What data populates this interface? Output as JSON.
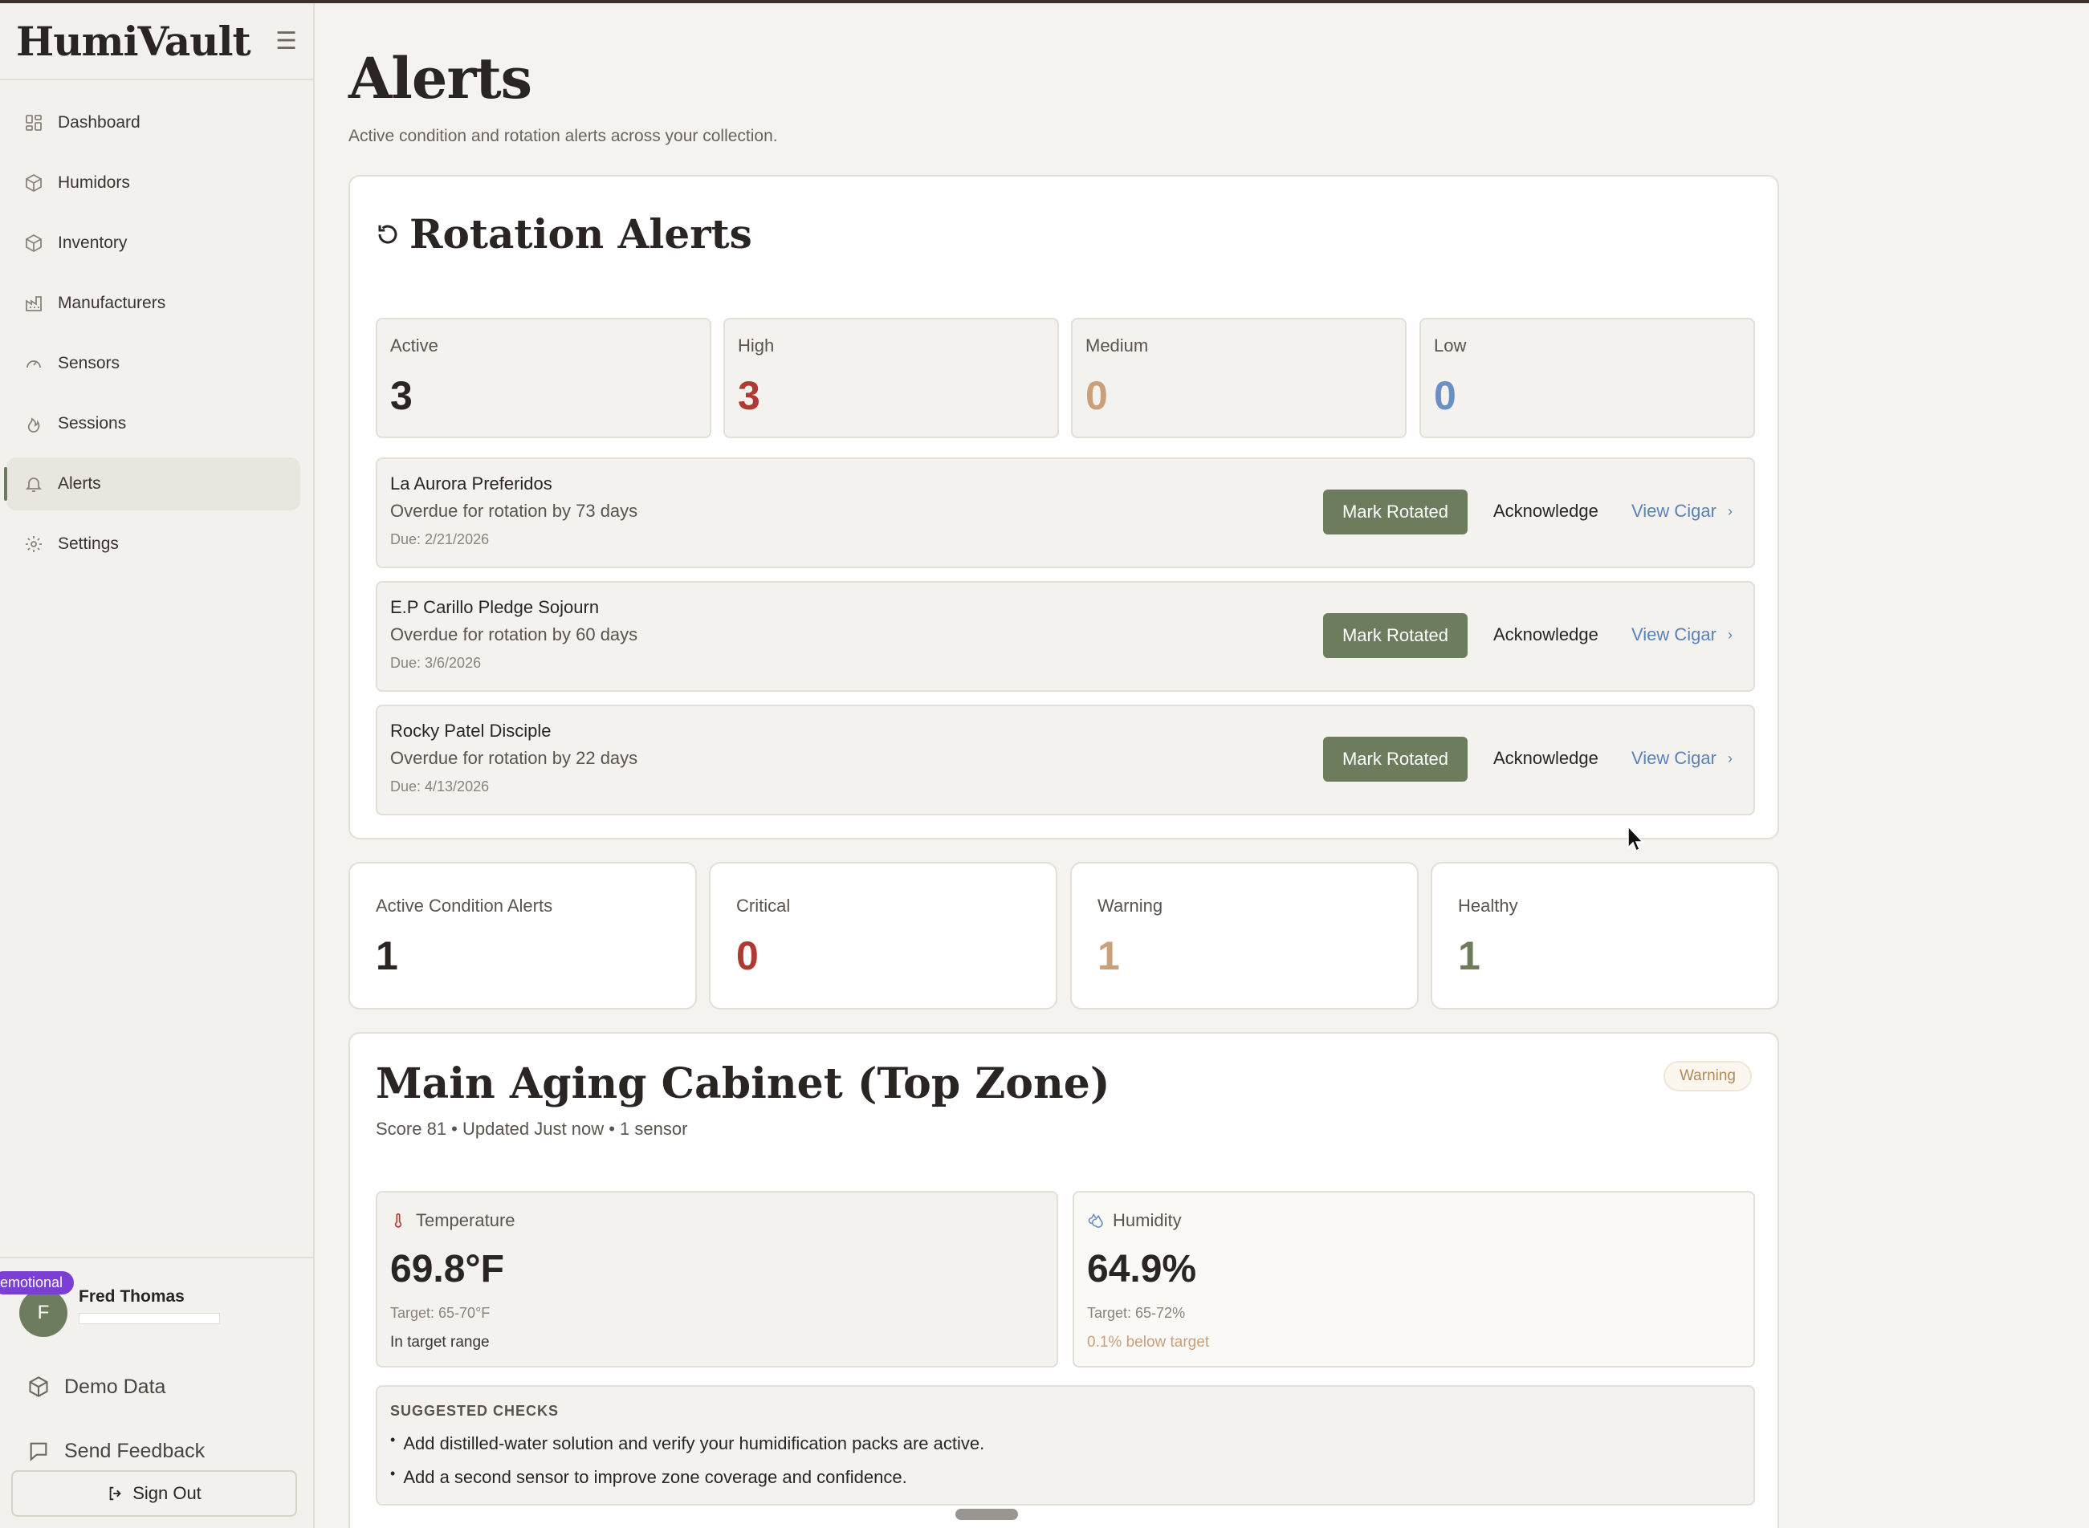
{
  "app": {
    "brand": "HumiVault"
  },
  "sidebar": {
    "items": [
      {
        "label": "Dashboard",
        "icon": "dashboard-icon"
      },
      {
        "label": "Humidors",
        "icon": "box-icon"
      },
      {
        "label": "Inventory",
        "icon": "box-icon"
      },
      {
        "label": "Manufacturers",
        "icon": "factory-icon"
      },
      {
        "label": "Sensors",
        "icon": "gauge-icon"
      },
      {
        "label": "Sessions",
        "icon": "flame-icon"
      },
      {
        "label": "Alerts",
        "icon": "bell-icon",
        "active": true
      },
      {
        "label": "Settings",
        "icon": "gear-icon"
      }
    ],
    "user": {
      "name": "Fred Thomas",
      "initial": "F",
      "badge": "emotional"
    },
    "demo_data": "Demo Data",
    "send_feedback": "Send Feedback",
    "sign_out": "Sign Out"
  },
  "page": {
    "title": "Alerts",
    "subtitle": "Active condition and rotation alerts across your collection."
  },
  "rotation": {
    "title": "Rotation Alerts",
    "stats": [
      {
        "label": "Active",
        "value": "3",
        "color": "#2a2522"
      },
      {
        "label": "High",
        "value": "3",
        "color": "#b03a33"
      },
      {
        "label": "Medium",
        "value": "0",
        "color": "#c9a07a"
      },
      {
        "label": "Low",
        "value": "0",
        "color": "#6b8fc4"
      }
    ],
    "alerts": [
      {
        "name": "La Aurora Preferidos",
        "desc": "Overdue for rotation by 73 days",
        "due": "Due: 2/21/2026"
      },
      {
        "name": "E.P Carillo Pledge Sojourn",
        "desc": "Overdue for rotation by 60 days",
        "due": "Due: 3/6/2026"
      },
      {
        "name": "Rocky Patel Disciple",
        "desc": "Overdue for rotation by 22 days",
        "due": "Due: 4/13/2026"
      }
    ],
    "mark_rotated": "Mark Rotated",
    "acknowledge": "Acknowledge",
    "view_cigar": "View Cigar",
    "chevron": "›"
  },
  "condition": {
    "stats": [
      {
        "label": "Active Condition Alerts",
        "value": "1",
        "color": "#2a2522"
      },
      {
        "label": "Critical",
        "value": "0",
        "color": "#b03a33"
      },
      {
        "label": "Warning",
        "value": "1",
        "color": "#c9a07a"
      },
      {
        "label": "Healthy",
        "value": "1",
        "color": "#6e7c5e"
      }
    ]
  },
  "zone": {
    "title": "Main Aging Cabinet (Top Zone)",
    "meta": "Score 81 • Updated Just now • 1 sensor",
    "badge": "Warning",
    "temperature": {
      "label": "Temperature",
      "value": "69.8°F",
      "target": "Target: 65-70°F",
      "status": "In target range"
    },
    "humidity": {
      "label": "Humidity",
      "value": "64.9%",
      "target": "Target: 65-72%",
      "status": "0.1% below target"
    },
    "checks": {
      "heading": "SUGGESTED CHECKS",
      "items": [
        "Add distilled-water solution and verify your humidification packs are active.",
        "Add a second sensor to improve zone coverage and confidence."
      ]
    }
  },
  "colors": {
    "accent": "#6e7c5e",
    "link": "#5a82b8",
    "danger": "#b03a33",
    "warning": "#c9a07a"
  }
}
